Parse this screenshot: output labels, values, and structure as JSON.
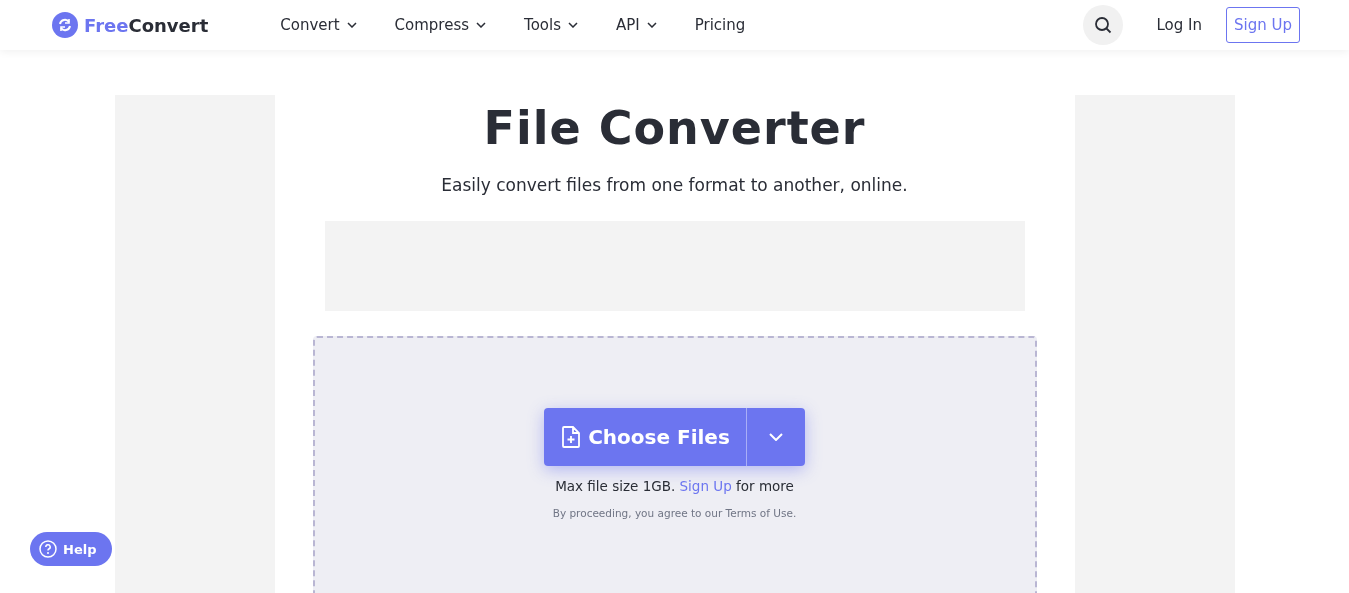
{
  "header": {
    "logo": {
      "accent": "Free",
      "rest": "Convert"
    },
    "nav": [
      {
        "label": "Convert",
        "dropdown": true
      },
      {
        "label": "Compress",
        "dropdown": true
      },
      {
        "label": "Tools",
        "dropdown": true
      },
      {
        "label": "API",
        "dropdown": true
      },
      {
        "label": "Pricing",
        "dropdown": false
      }
    ],
    "login": "Log In",
    "signup": "Sign Up"
  },
  "title": "File Converter",
  "subtitle": "Easily convert files from one format to another, online.",
  "upload": {
    "button": "Choose Files",
    "max_size": {
      "before": "Max file size 1GB.",
      "link": "Sign Up",
      "after": "for more"
    },
    "terms": {
      "before": "By proceeding, you agree to our",
      "link": "Terms of Use",
      "after": "."
    }
  },
  "help": "Help"
}
